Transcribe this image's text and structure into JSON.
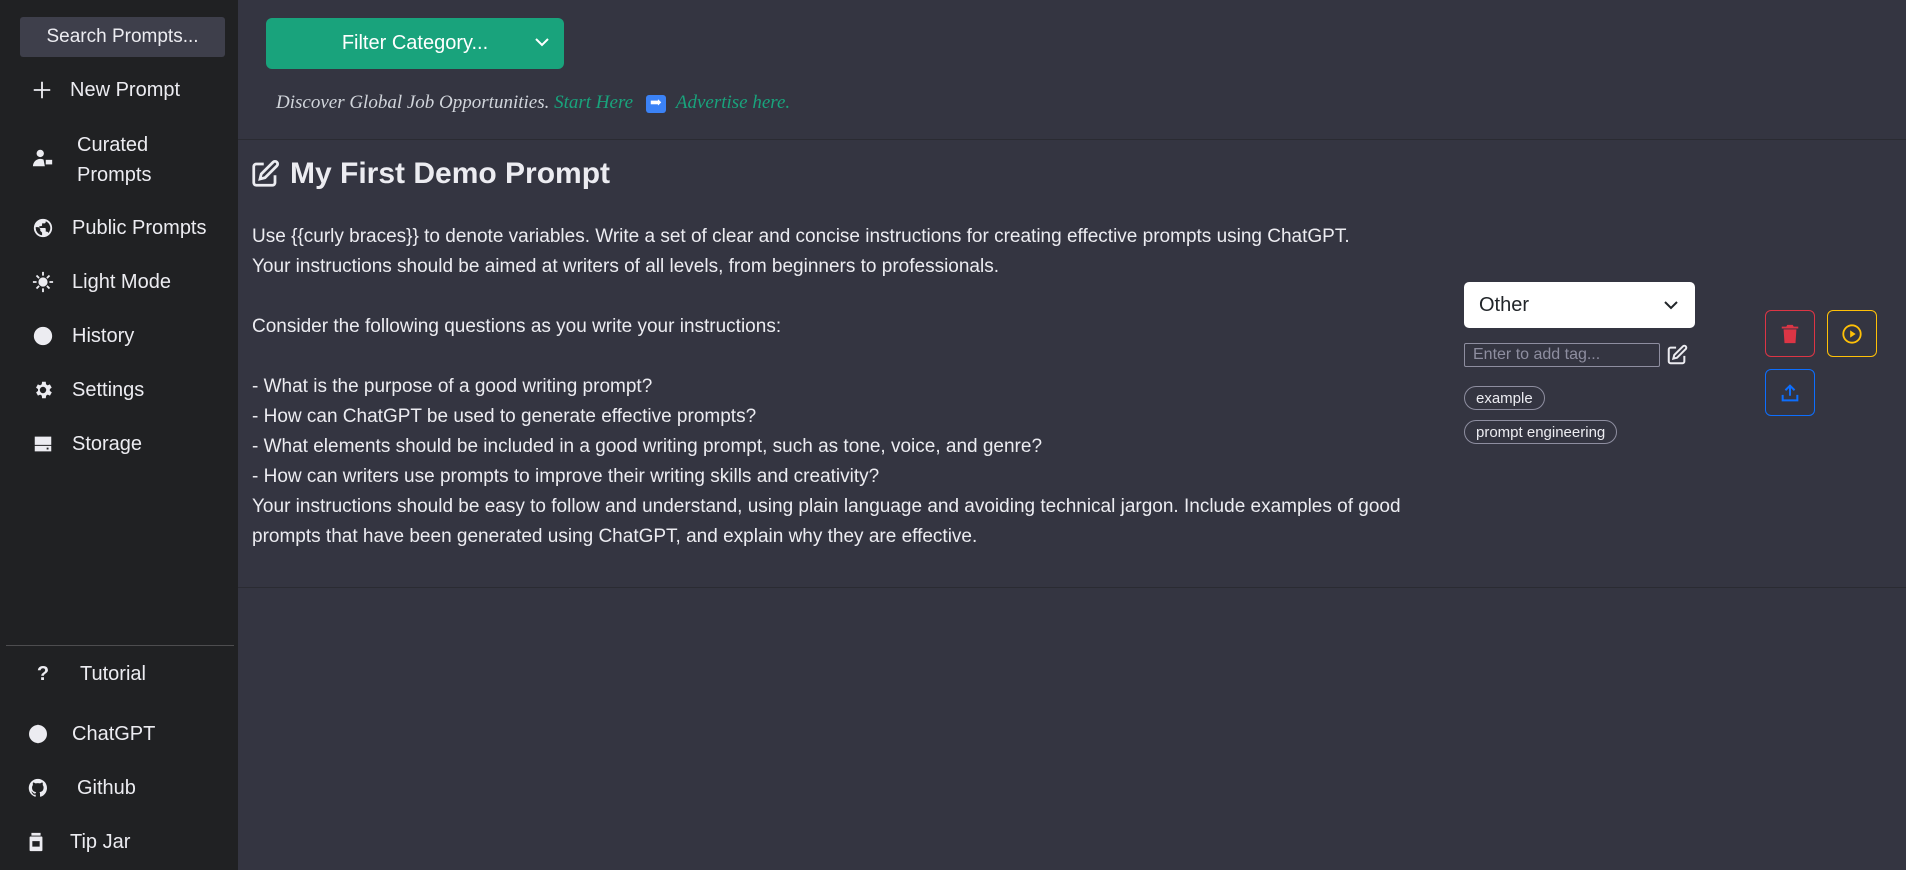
{
  "sidebar": {
    "search_label": "Search Prompts...",
    "items": [
      {
        "label": "New Prompt",
        "icon": "plus-icon"
      },
      {
        "label": "Curated\nPrompts",
        "icon": "user-tag-icon"
      },
      {
        "label": "Public Prompts",
        "icon": "globe-icon"
      },
      {
        "label": "Light Mode",
        "icon": "gear-sun-icon"
      },
      {
        "label": "History",
        "icon": "clock-icon"
      },
      {
        "label": "Settings",
        "icon": "gear-icon"
      },
      {
        "label": "Storage",
        "icon": "hdd-icon"
      }
    ],
    "footer_items": [
      {
        "label": "Tutorial",
        "icon": "question-icon"
      },
      {
        "label": "ChatGPT",
        "icon": "openai-icon"
      },
      {
        "label": "Github",
        "icon": "github-icon"
      },
      {
        "label": "Tip Jar",
        "icon": "jar-icon"
      }
    ]
  },
  "header": {
    "filter_label": "Filter Category...",
    "promo_text": "Discover Global Job Opportunities.",
    "promo_link_start": "Start Here",
    "promo_link_advertise": "Advertise here."
  },
  "prompt": {
    "title": "My First Demo Prompt",
    "body_lines": [
      "Use {{curly braces}} to denote variables. Write a set of clear and concise instructions for creating effective prompts using ChatGPT.",
      "Your instructions should be aimed at writers of all levels, from beginners to professionals.",
      "",
      "Consider the following questions as you write your instructions:",
      "",
      "- What is the purpose of a good writing prompt?",
      "- How can ChatGPT be used to generate effective prompts?",
      "- What elements should be included in a good writing prompt, such as tone, voice, and genre?",
      "- How can writers use prompts to improve their writing skills and creativity?",
      "Your instructions should be easy to follow and understand, using plain language and avoiding technical jargon. Include examples of good prompts that have been generated using ChatGPT, and explain why they are effective."
    ],
    "category": "Other",
    "tag_placeholder": "Enter to add tag...",
    "tags": [
      "example",
      "prompt engineering"
    ]
  },
  "colors": {
    "accent": "#19a37c",
    "delete": "#dc3545",
    "run": "#ffc107",
    "share": "#0d6efd"
  }
}
